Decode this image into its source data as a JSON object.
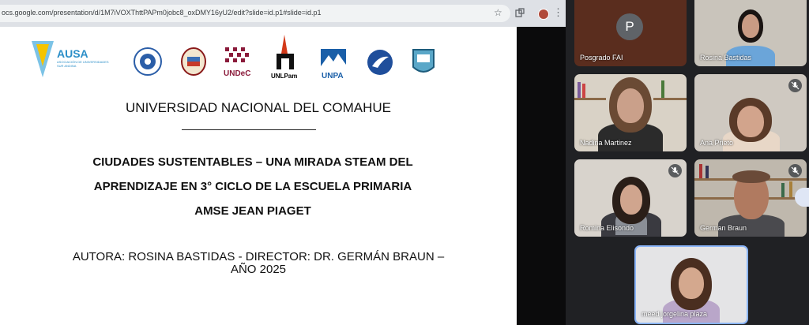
{
  "browser": {
    "url": "ocs.google.com/presentation/d/1M7iVOXThttPAPm0jobc8_oxDMY16yU2/edit?slide=id.p1#slide=id.p1",
    "icons": [
      "star-icon",
      "extensions-icon",
      "profile-avatar",
      "menu-kebab-icon"
    ],
    "menu_glyph": "⋮"
  },
  "slide": {
    "logos": [
      "AUSA",
      "UNDeC",
      "UNLPam",
      "UNPA"
    ],
    "ausa_label": "AUSA",
    "ausa_sub": "ASOCIACIÓN DE UNIVERSIDADES SUR ANDINA",
    "undec_label": "UNDeC",
    "unlpam_label": "UNLPam",
    "unpa_label": "UNPA",
    "university": "UNIVERSIDAD NACIONAL DEL COMAHUE",
    "thesis_line1": "CIUDADES SUSTENTABLES – UNA MIRADA STEAM DEL",
    "thesis_line2": "APRENDIZAJE EN 3° CICLO DE LA ESCUELA PRIMARIA",
    "thesis_line3": "AMSE JEAN PIAGET",
    "authors_line1": "AUTORA: ROSINA BASTIDAS - DIRECTOR: DR. GERMÁN BRAUN –",
    "authors_line2": "AÑO 2025"
  },
  "meet": {
    "participants": [
      {
        "name": "Posgrado FAI",
        "avatar_letter": "P",
        "muted": false
      },
      {
        "name": "Rosina Bastidas",
        "muted": true
      },
      {
        "name": "Nadina Martinez",
        "muted": false
      },
      {
        "name": "Ana Prieto",
        "muted": true
      },
      {
        "name": "Romina Elisondo",
        "muted": true
      },
      {
        "name": "German Braun",
        "muted": true
      },
      {
        "name": "meed jorgelina plaza",
        "muted": false
      }
    ],
    "colors": {
      "tile_bg": "#3c4043",
      "active_border": "#8ab4f8",
      "page_bg": "#202124"
    }
  }
}
